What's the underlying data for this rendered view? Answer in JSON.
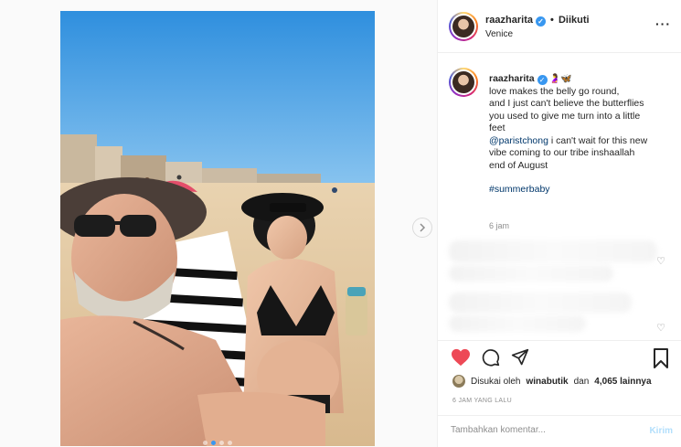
{
  "header": {
    "username": "raazharita",
    "separator": "•",
    "follow_state": "Diikuti",
    "location": "Venice",
    "more_label": "···"
  },
  "caption": {
    "username": "raazharita",
    "emoji": "🤰🦋",
    "lines": [
      "love makes the belly go round,",
      "and I just can't believe the butterflies",
      "you used to give me turn into a little",
      "feet"
    ],
    "mention": "@paristchong",
    "after_mention_lines": [
      " i can't wait for this new",
      "vibe coming to our tribe inshaallah",
      "end of August"
    ],
    "hashtag": "#summerbaby",
    "time": "6 jam"
  },
  "likes": {
    "prefix": "Disukai oleh",
    "user": "winabutik",
    "connector": "dan",
    "others": "4,065 lainnya"
  },
  "posted_ago": "6 JAM YANG LALU",
  "comment": {
    "placeholder": "Tambahkan komentar...",
    "post_label": "Kirim"
  },
  "icons": {
    "verified": "verified-badge-icon",
    "like": "heart-filled-icon",
    "comment": "comment-bubble-icon",
    "share": "paper-plane-icon",
    "save": "bookmark-icon",
    "next": "chevron-right-icon"
  },
  "colors": {
    "like_red": "#ed4956",
    "link_blue": "#00376b",
    "verified_blue": "#3897f0"
  },
  "carousel": {
    "count": 4,
    "active_index": 1
  }
}
